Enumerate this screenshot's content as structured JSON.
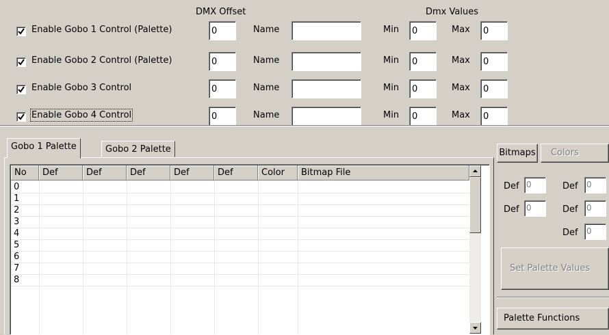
{
  "headers": {
    "dmx_offset": "DMX Offset",
    "dmx_values": "Dmx Values"
  },
  "labels": {
    "name": "Name",
    "min": "Min",
    "max": "Max"
  },
  "gobo_rows": [
    {
      "label": "Enable Gobo 1 Control (Palette)",
      "checked": true,
      "offset": "0",
      "name": "",
      "min": "0",
      "max": "0"
    },
    {
      "label": "Enable Gobo 2 Control (Palette)",
      "checked": true,
      "offset": "0",
      "name": "",
      "min": "0",
      "max": "0"
    },
    {
      "label": "Enable Gobo 3 Control",
      "checked": true,
      "offset": "0",
      "name": "",
      "min": "0",
      "max": "0"
    },
    {
      "label": "Enable Gobo 4 Control",
      "checked": true,
      "offset": "0",
      "name": "",
      "min": "0",
      "max": "0"
    }
  ],
  "tabs": [
    {
      "label": "Gobo 1 Palette",
      "active": true
    },
    {
      "label": "Gobo 2 Palette",
      "active": false
    }
  ],
  "grid": {
    "columns": [
      "No",
      "Def",
      "Def",
      "Def",
      "Def",
      "Def",
      "Color",
      "Bitmap File"
    ],
    "rows": [
      "0",
      "1",
      "2",
      "3",
      "4",
      "5",
      "6",
      "7",
      "8"
    ]
  },
  "side": {
    "bitmaps": "Bitmaps",
    "colors": "Colors",
    "def_label": "Def",
    "def_values": [
      "0",
      "0",
      "0",
      "0",
      "0"
    ],
    "set_palette": "Set Palette Values",
    "palette_functions": "Palette Functions"
  },
  "icons": {
    "checkbox": "checkmark-icon",
    "scroll_up": "arrow-up-icon",
    "scroll_down": "arrow-down-icon"
  }
}
